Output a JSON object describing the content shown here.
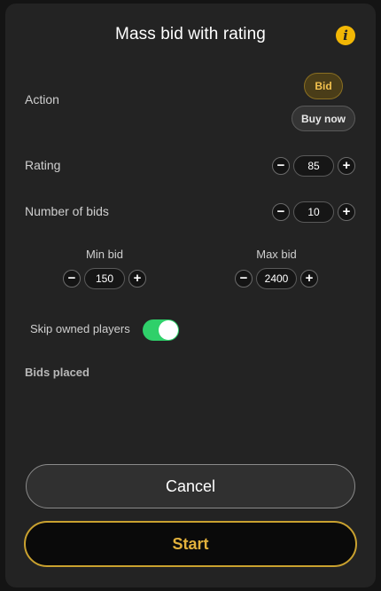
{
  "modal": {
    "title": "Mass bid with rating",
    "info_icon": "info-icon"
  },
  "action": {
    "label": "Action",
    "options": [
      "Bid",
      "Buy now"
    ],
    "selected": "Bid"
  },
  "rating": {
    "label": "Rating",
    "value": "85",
    "minus": "−",
    "plus": "+"
  },
  "number_of_bids": {
    "label": "Number of bids",
    "value": "10",
    "minus": "−",
    "plus": "+"
  },
  "min_bid": {
    "label": "Min bid",
    "value": "150",
    "minus": "−",
    "plus": "+"
  },
  "max_bid": {
    "label": "Max bid",
    "value": "2400",
    "minus": "−",
    "plus": "+"
  },
  "skip_owned": {
    "label": "Skip owned players",
    "enabled": true
  },
  "bids_placed": {
    "label": "Bids placed"
  },
  "buttons": {
    "cancel": "Cancel",
    "start": "Start"
  },
  "colors": {
    "accent_gold": "#e2b13c",
    "toggle_on": "#2fd06a",
    "info_icon": "#f2b705",
    "panel": "#232323"
  }
}
